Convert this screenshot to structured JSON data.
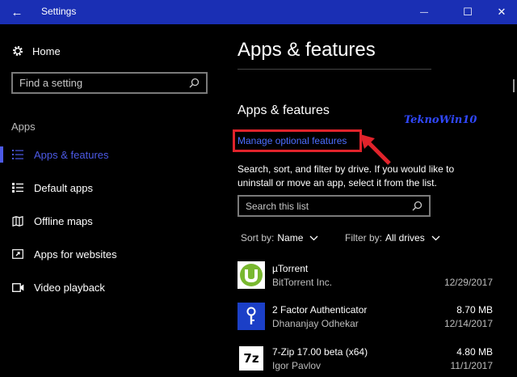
{
  "window": {
    "title": "Settings",
    "back_glyph": "←",
    "min_glyph": "—",
    "max_glyph": "☐",
    "close_glyph": "✕"
  },
  "sidebar": {
    "home_label": "Home",
    "search_placeholder": "Find a setting",
    "section_label": "Apps",
    "items": [
      {
        "label": "Apps & features",
        "icon": "list-icon",
        "active": true
      },
      {
        "label": "Default apps",
        "icon": "default-apps-icon",
        "active": false
      },
      {
        "label": "Offline maps",
        "icon": "map-icon",
        "active": false
      },
      {
        "label": "Apps for websites",
        "icon": "open-external-icon",
        "active": false
      },
      {
        "label": "Video playback",
        "icon": "video-icon",
        "active": false
      }
    ]
  },
  "main": {
    "page_title": "Apps & features",
    "watermark": "TeknoWin10",
    "sub_title": "Apps & features",
    "link_label": "Manage optional features",
    "description": "Search, sort, and filter by drive. If you would like to uninstall or move an app, select it from the list.",
    "search_placeholder": "Search this list",
    "sort_label": "Sort by:",
    "sort_value": "Name",
    "filter_label": "Filter by:",
    "filter_value": "All drives",
    "apps": [
      {
        "name": "µTorrent",
        "publisher": "BitTorrent Inc.",
        "size": "",
        "date": "12/29/2017",
        "icon": "utorrent-icon"
      },
      {
        "name": "2 Factor Authenticator",
        "publisher": "Dhananjay Odhekar",
        "size": "8.70 MB",
        "date": "12/14/2017",
        "icon": "key-lock-icon"
      },
      {
        "name": "7-Zip 17.00 beta (x64)",
        "publisher": "Igor Pavlov",
        "size": "4.80 MB",
        "date": "11/1/2017",
        "icon": "7zip-icon",
        "icon_text": "7z"
      }
    ]
  },
  "colors": {
    "accent": "#4c5ae6",
    "titlebar": "#1a2fb4",
    "highlight_red": "#e0232b",
    "link": "#4c6dff"
  }
}
